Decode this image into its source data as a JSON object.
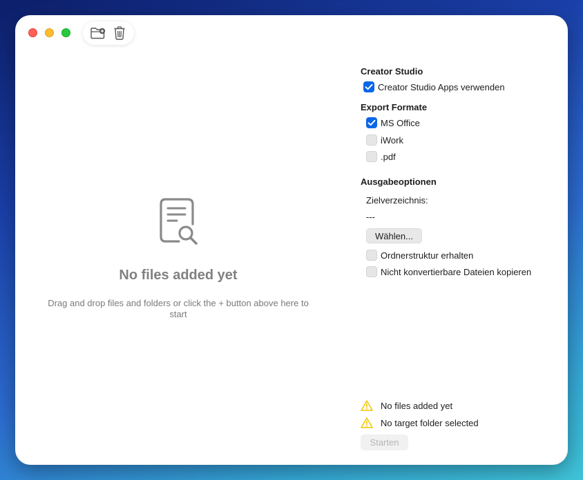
{
  "toolbar": {
    "add_icon": "folder-plus-icon",
    "delete_icon": "trash-icon"
  },
  "empty_state": {
    "icon": "document-search-icon",
    "title": "No files added yet",
    "subtitle": "Drag and drop files and folders or click the + button above here to start"
  },
  "creator_studio": {
    "title": "Creator Studio",
    "use_apps": {
      "label": "Creator Studio Apps verwenden",
      "checked": true
    }
  },
  "export_formats": {
    "title": "Export Formate",
    "options": [
      {
        "label": "MS Office",
        "checked": true
      },
      {
        "label": "iWork",
        "checked": false
      },
      {
        "label": ".pdf",
        "checked": false
      }
    ]
  },
  "output_options": {
    "title": "Ausgabeoptionen",
    "target_label": "Zielverzeichnis:",
    "target_value": "---",
    "choose_label": "Wählen...",
    "keep_structure": {
      "label": "Ordnerstruktur erhalten",
      "checked": false
    },
    "copy_unconvertible": {
      "label": "Nicht konvertierbare Dateien kopieren",
      "checked": false
    }
  },
  "status": {
    "warnings": [
      "No files added yet",
      "No target folder selected"
    ],
    "warning_color": "#f5c400",
    "start_label": "Starten"
  },
  "colors": {
    "accent": "#0a66e8",
    "close": "#fe5f57",
    "minimize": "#febc2e",
    "zoom": "#28c840"
  }
}
